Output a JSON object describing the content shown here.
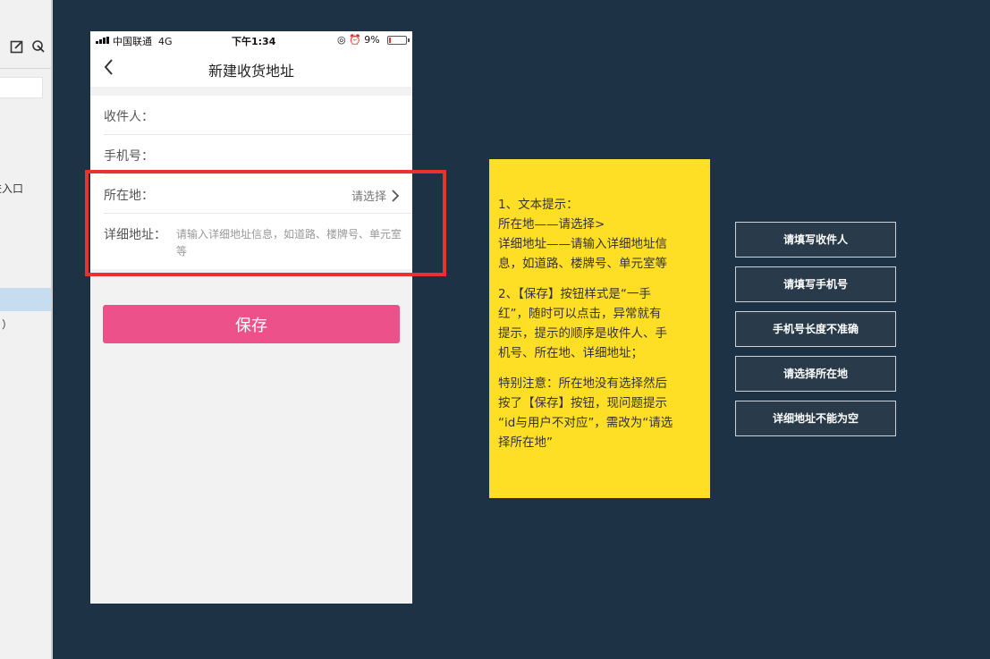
{
  "sidebar": {
    "text_entry": "进入口",
    "text_paren": "）"
  },
  "phone": {
    "status": {
      "carrier": "中国联通",
      "network": "4G",
      "time": "下午1:34",
      "icons": "◎ ⏰",
      "battery": "9%"
    },
    "nav_title": "新建收货地址",
    "form": {
      "recipient_label": "收件人：",
      "phone_label": "手机号：",
      "location_label": "所在地：",
      "location_placeholder": "请选择",
      "address_label": "详细地址：",
      "address_placeholder": "请输入详细地址信息，如道路、楼牌号、单元室等"
    },
    "save_label": "保存"
  },
  "note": {
    "lines1": [
      "1、文本提示：",
      "所在地——请选择>",
      "详细地址——请输入详细地址信",
      "息，如道路、楼牌号、单元室等"
    ],
    "lines2": [
      "2、【保存】按钮样式是“一手",
      "红”，随时可以点击，异常就有",
      "提示，提示的顺序是收件人、手",
      "机号、所在地、详细地址；"
    ],
    "lines3": [
      "特别注意：所在地没有选择然后",
      "按了【保存】按钮，现问题提示",
      "“id与用户不对应”，需改为“请选",
      "择所在地”"
    ]
  },
  "messages": [
    "请填写收件人",
    "请填写手机号",
    "手机号长度不准确",
    "请选择所在地",
    "详细地址不能为空"
  ],
  "colors": {
    "canvas": "#1e3246",
    "save_button": "#ec5189",
    "highlight": "#e8322f",
    "note": "#ffdf25",
    "message_bg": "#293b4b"
  }
}
